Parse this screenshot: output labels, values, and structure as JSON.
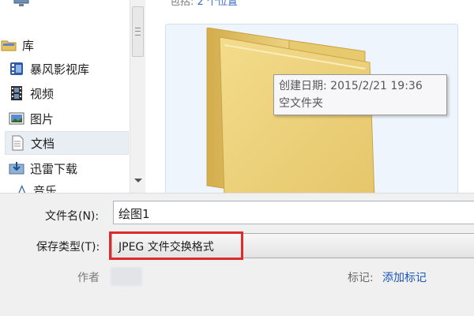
{
  "content": {
    "header_prefix": "包括:",
    "header_link": "2 个位置"
  },
  "nav": {
    "items": [
      {
        "label": "库",
        "icon": "library-icon"
      },
      {
        "label": "暴风影视库",
        "icon": "video-library-icon"
      },
      {
        "label": "视频",
        "icon": "film-icon"
      },
      {
        "label": "图片",
        "icon": "pictures-icon"
      },
      {
        "label": "文档",
        "icon": "documents-icon",
        "selected": true
      },
      {
        "label": "迅雷下载",
        "icon": "thunder-download-icon"
      },
      {
        "label": "音乐",
        "icon": "music-icon"
      }
    ]
  },
  "tooltip": {
    "created": "创建日期: 2015/2/21 19:36",
    "description": "空文件夹"
  },
  "form": {
    "filename_label": "文件名(N):",
    "filename_value": "绘图1",
    "savetype_label": "保存类型(T):",
    "savetype_value": "JPEG 文件交换格式",
    "author_label": "作者",
    "tags_label": "标记:",
    "tags_link": "添加标记"
  },
  "colors": {
    "highlight": "#e02a2a",
    "link": "#1a55b8",
    "selection": "#e9eef4"
  }
}
